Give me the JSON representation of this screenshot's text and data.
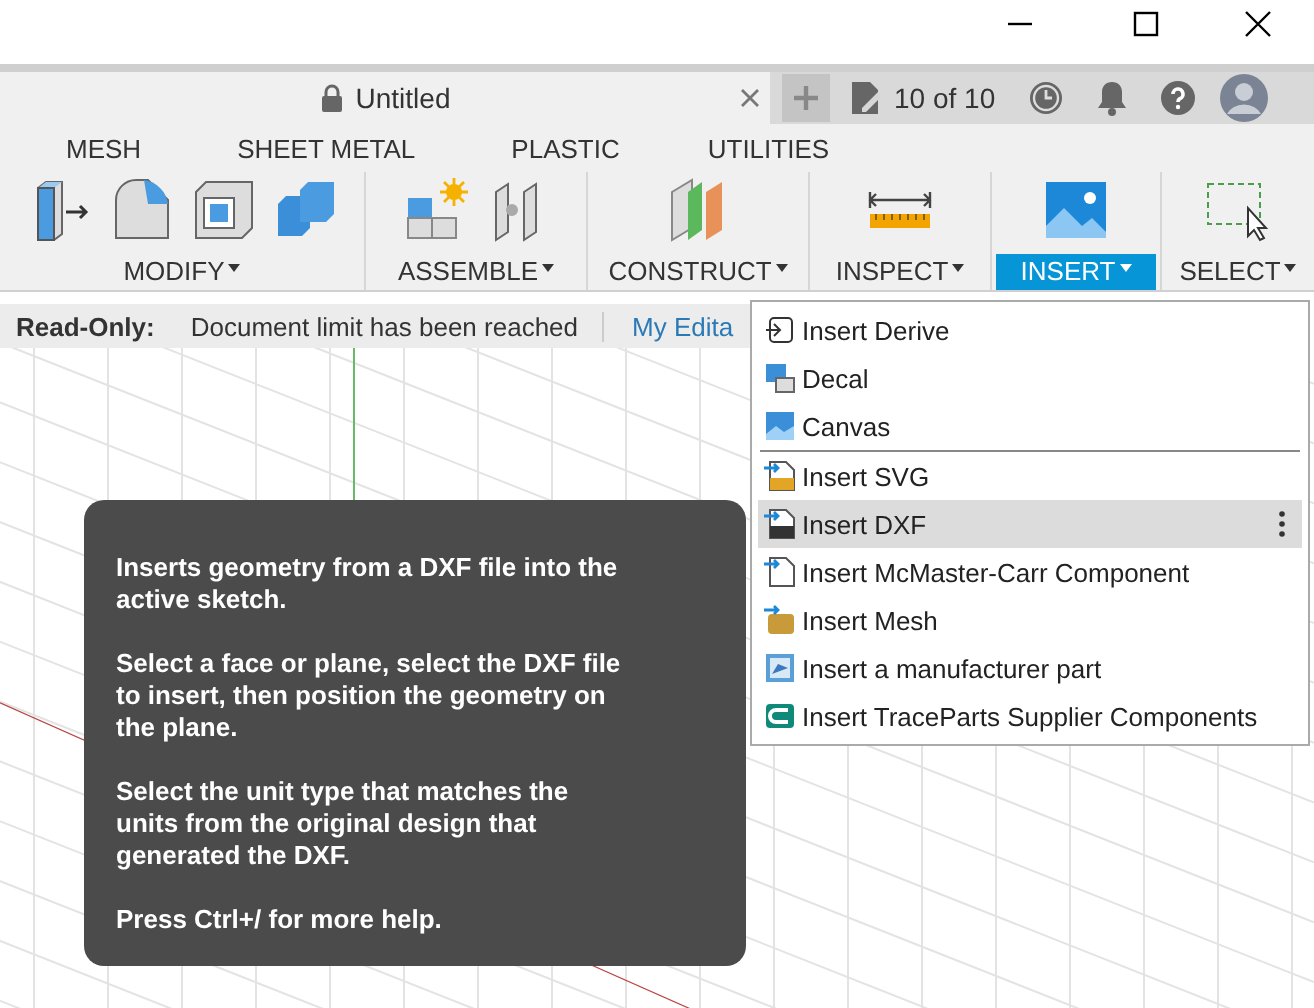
{
  "document_tab": {
    "title": "Untitled",
    "locked": true
  },
  "doc_count": "10 of 10",
  "tabs": [
    {
      "label": "MESH"
    },
    {
      "label": "SHEET METAL"
    },
    {
      "label": "PLASTIC"
    },
    {
      "label": "UTILITIES"
    }
  ],
  "toolbar_groups": [
    {
      "label": "MODIFY",
      "kind": "modify",
      "selected": false
    },
    {
      "label": "ASSEMBLE",
      "kind": "assemble",
      "selected": false
    },
    {
      "label": "CONSTRUCT",
      "kind": "construct",
      "selected": false
    },
    {
      "label": "INSPECT",
      "kind": "inspect",
      "selected": false
    },
    {
      "label": "INSERT",
      "kind": "insert",
      "selected": true
    },
    {
      "label": "SELECT",
      "kind": "select",
      "selected": false
    }
  ],
  "notice_bar": {
    "label": "Read-Only:",
    "message": "Document limit has been reached",
    "link": "My Edita"
  },
  "insert_menu": [
    {
      "label": "Insert Derive",
      "kind": "derive",
      "selected": false,
      "separator_after": false
    },
    {
      "label": "Decal",
      "kind": "decal",
      "selected": false,
      "separator_after": false
    },
    {
      "label": "Canvas",
      "kind": "canvas",
      "selected": false,
      "separator_after": true
    },
    {
      "label": "Insert SVG",
      "kind": "svg",
      "selected": false,
      "separator_after": false
    },
    {
      "label": "Insert DXF",
      "kind": "dxf",
      "selected": true,
      "separator_after": false
    },
    {
      "label": "Insert McMaster-Carr Component",
      "kind": "mcmaster",
      "selected": false,
      "separator_after": false
    },
    {
      "label": "Insert Mesh",
      "kind": "mesh",
      "selected": false,
      "separator_after": false
    },
    {
      "label": "Insert a manufacturer part",
      "kind": "manufacturer",
      "selected": false,
      "separator_after": false
    },
    {
      "label": "Insert TraceParts Supplier Components",
      "kind": "traceparts",
      "selected": false,
      "separator_after": false
    }
  ],
  "tooltip": {
    "paragraphs": [
      "Inserts geometry from a DXF file into the active sketch.",
      "Select a face or plane, select the DXF file to insert, then position the geometry on the plane.",
      "Select the unit type that matches the units from the original design that generated the DXF.",
      "Press Ctrl+/ for more help."
    ]
  }
}
